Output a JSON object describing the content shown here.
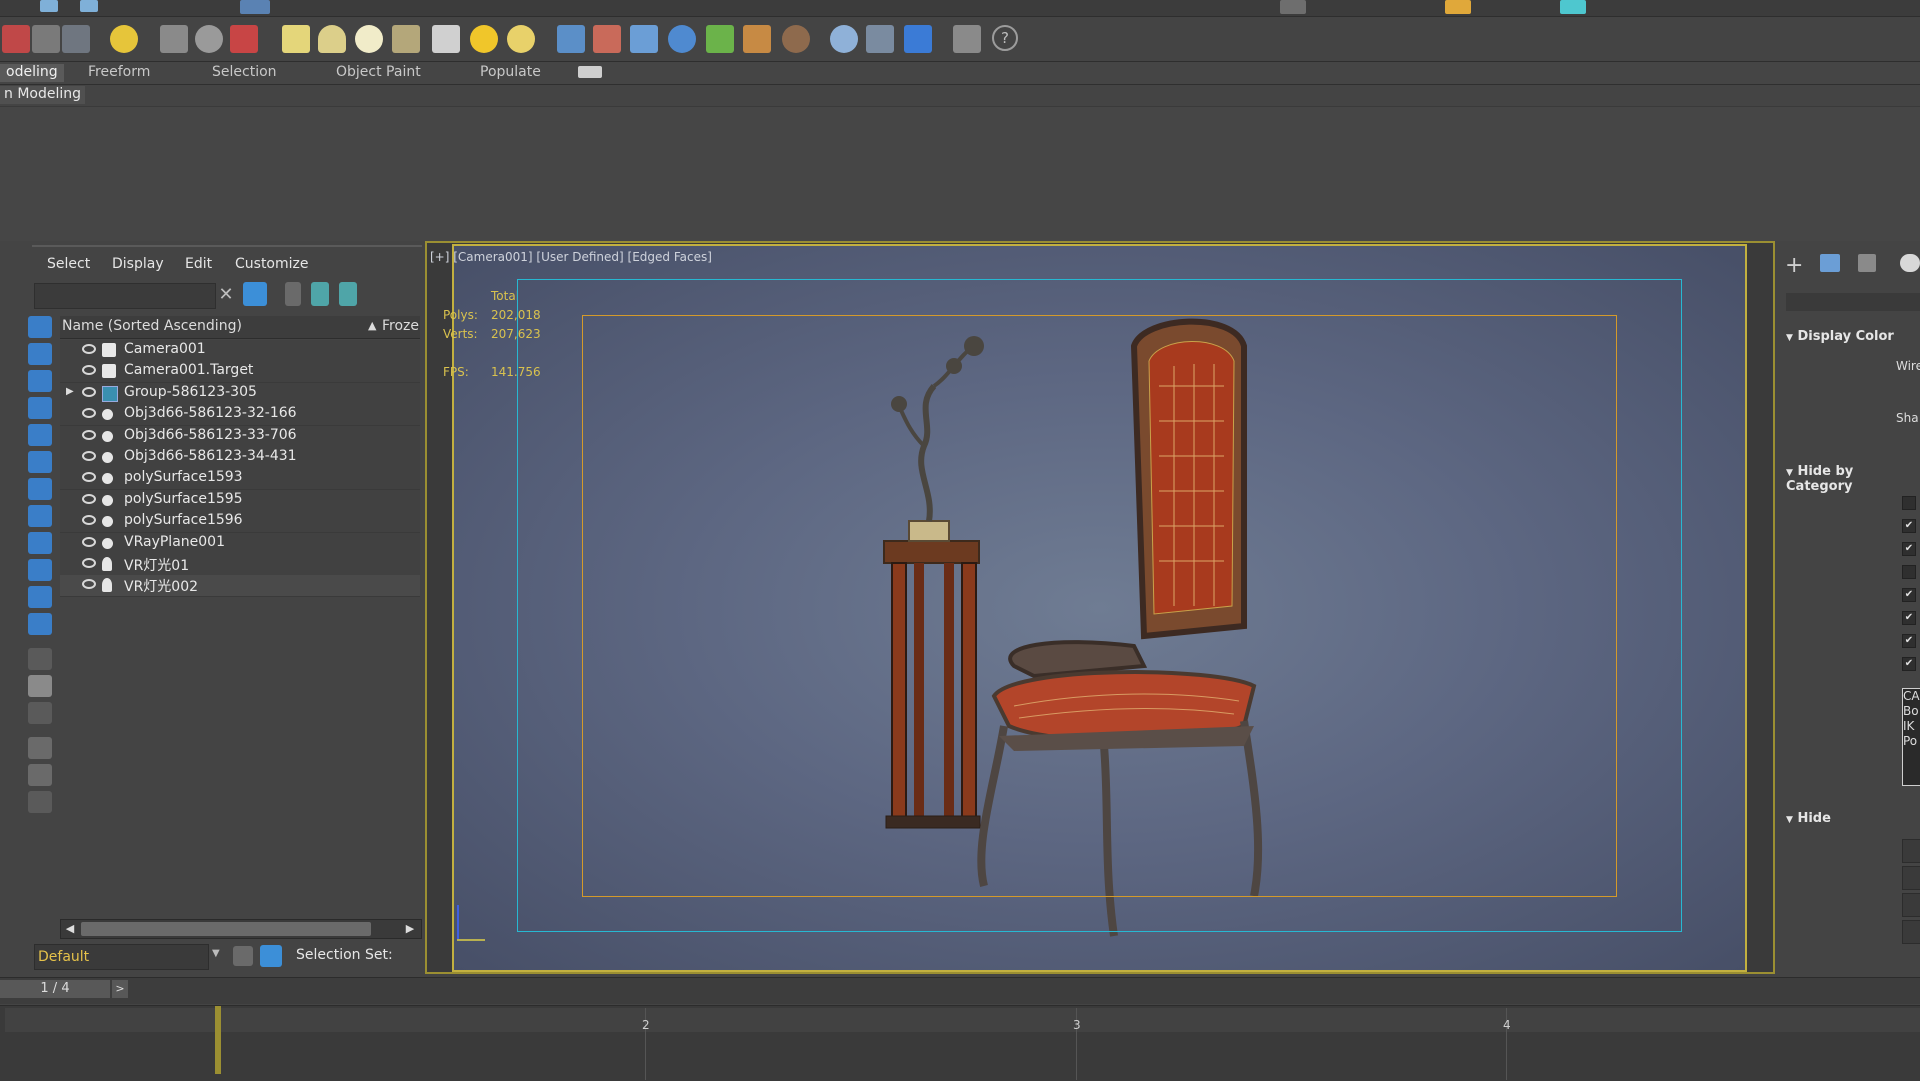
{
  "ribbon": {
    "tabs": [
      "odeling",
      "Freeform",
      "Selection",
      "Object Paint",
      "Populate"
    ],
    "active_subtab": "n Modeling"
  },
  "explorer": {
    "menu": [
      "Select",
      "Display",
      "Edit",
      "Customize"
    ],
    "search_value": "",
    "column_name": "Name (Sorted Ascending)",
    "column_frozen": "Froze",
    "sort_indicator": "▲",
    "objects": [
      {
        "name": "Camera001",
        "type": "camera"
      },
      {
        "name": "Camera001.Target",
        "type": "camera"
      },
      {
        "name": "Group-586123-305",
        "type": "group"
      },
      {
        "name": "Obj3d66-586123-32-166",
        "type": "geometry"
      },
      {
        "name": "Obj3d66-586123-33-706",
        "type": "geometry"
      },
      {
        "name": "Obj3d66-586123-34-431",
        "type": "geometry"
      },
      {
        "name": "polySurface1593",
        "type": "geometry"
      },
      {
        "name": "polySurface1595",
        "type": "geometry"
      },
      {
        "name": "polySurface1596",
        "type": "geometry"
      },
      {
        "name": "VRayPlane001",
        "type": "geometry"
      },
      {
        "name": "VR灯光01",
        "type": "light"
      },
      {
        "name": "VR灯光002",
        "type": "light"
      }
    ],
    "layer": "Default",
    "selection_set_label": "Selection Set:"
  },
  "viewport": {
    "label": "[+] [Camera001] [User Defined] [Edged Faces]",
    "stats_total": "Total",
    "polys_label": "Polys:",
    "polys_value": "202,018",
    "verts_label": "Verts:",
    "verts_value": "207,623",
    "fps_label": "FPS:",
    "fps_value": "141.756"
  },
  "command_panel": {
    "rollouts": [
      "Display Color",
      "Hide by Category",
      "Hide"
    ],
    "display_color_fields": [
      "Wire",
      "Sha"
    ],
    "category_list": [
      "CA",
      "Bo",
      "IK",
      "Po"
    ]
  },
  "timeline": {
    "frame_counter": "1 / 4",
    "ticks": [
      "2",
      "3",
      "4"
    ]
  },
  "colors": {
    "accent": "#c2b040",
    "safe_frame_outer": "#27b8d2",
    "safe_frame_inner": "#d49a2a",
    "stats_text": "#d9c24e",
    "layer_text": "#e5c24a"
  }
}
